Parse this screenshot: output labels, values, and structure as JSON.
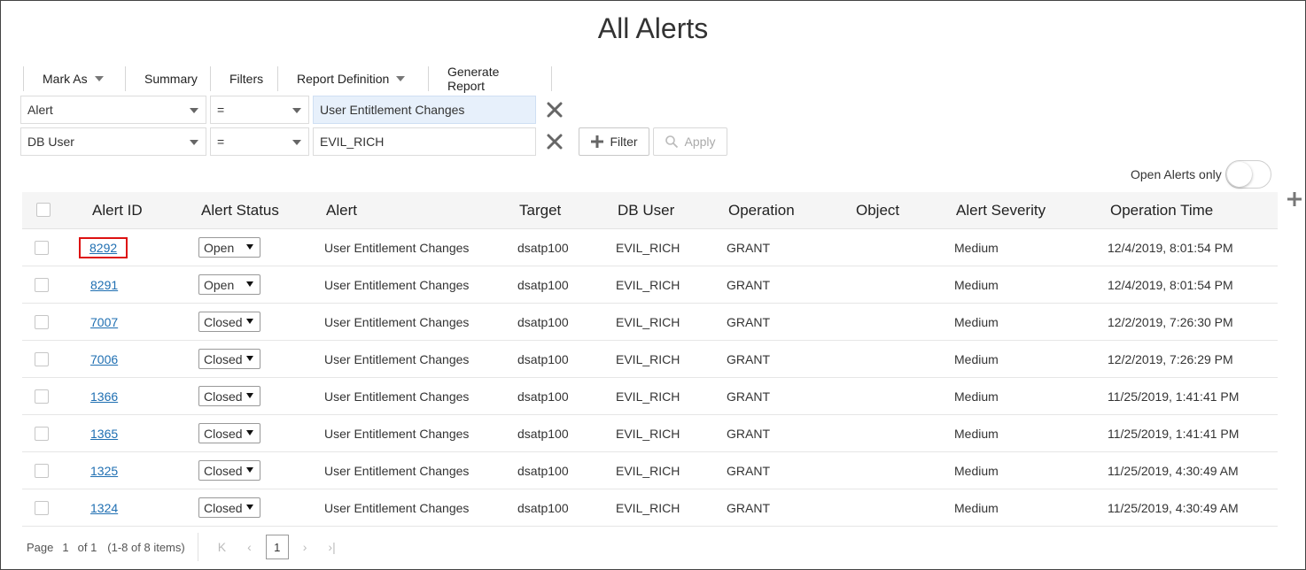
{
  "page": {
    "title": "All Alerts"
  },
  "toolbar": {
    "mark_as": "Mark As",
    "summary": "Summary",
    "filters": "Filters",
    "report_definition": "Report Definition",
    "generate_report": "Generate Report"
  },
  "filters": [
    {
      "field": "Alert",
      "operator": "=",
      "value": "User Entitlement Changes"
    },
    {
      "field": "DB User",
      "operator": "=",
      "value": "EVIL_RICH"
    }
  ],
  "buttons": {
    "add_filter": "Filter",
    "apply": "Apply"
  },
  "open_alerts_toggle": {
    "label": "Open Alerts only",
    "on": false
  },
  "columns": [
    "Alert ID",
    "Alert Status",
    "Alert",
    "Target",
    "DB User",
    "Operation",
    "Object",
    "Alert Severity",
    "Operation Time"
  ],
  "rows": [
    {
      "id": "8292",
      "status": "Open",
      "alert": "User Entitlement Changes",
      "target": "dsatp100",
      "db_user": "EVIL_RICH",
      "operation": "GRANT",
      "object": "",
      "severity": "Medium",
      "time": "12/4/2019, 8:01:54 PM"
    },
    {
      "id": "8291",
      "status": "Open",
      "alert": "User Entitlement Changes",
      "target": "dsatp100",
      "db_user": "EVIL_RICH",
      "operation": "GRANT",
      "object": "",
      "severity": "Medium",
      "time": "12/4/2019, 8:01:54 PM"
    },
    {
      "id": "7007",
      "status": "Closed",
      "alert": "User Entitlement Changes",
      "target": "dsatp100",
      "db_user": "EVIL_RICH",
      "operation": "GRANT",
      "object": "",
      "severity": "Medium",
      "time": "12/2/2019, 7:26:30 PM"
    },
    {
      "id": "7006",
      "status": "Closed",
      "alert": "User Entitlement Changes",
      "target": "dsatp100",
      "db_user": "EVIL_RICH",
      "operation": "GRANT",
      "object": "",
      "severity": "Medium",
      "time": "12/2/2019, 7:26:29 PM"
    },
    {
      "id": "1366",
      "status": "Closed",
      "alert": "User Entitlement Changes",
      "target": "dsatp100",
      "db_user": "EVIL_RICH",
      "operation": "GRANT",
      "object": "",
      "severity": "Medium",
      "time": "11/25/2019, 1:41:41 PM"
    },
    {
      "id": "1365",
      "status": "Closed",
      "alert": "User Entitlement Changes",
      "target": "dsatp100",
      "db_user": "EVIL_RICH",
      "operation": "GRANT",
      "object": "",
      "severity": "Medium",
      "time": "11/25/2019, 1:41:41 PM"
    },
    {
      "id": "1325",
      "status": "Closed",
      "alert": "User Entitlement Changes",
      "target": "dsatp100",
      "db_user": "EVIL_RICH",
      "operation": "GRANT",
      "object": "",
      "severity": "Medium",
      "time": "11/25/2019, 4:30:49 AM"
    },
    {
      "id": "1324",
      "status": "Closed",
      "alert": "User Entitlement Changes",
      "target": "dsatp100",
      "db_user": "EVIL_RICH",
      "operation": "GRANT",
      "object": "",
      "severity": "Medium",
      "time": "11/25/2019, 4:30:49 AM"
    }
  ],
  "pagination": {
    "page_label": "Page",
    "current_page": "1",
    "of_label": "of 1",
    "items_summary": "(1-8 of 8 items)",
    "page_button": "1"
  },
  "colors": {
    "link": "#1f6fb2",
    "highlight_box": "#d11111",
    "filter_value_bg": "#e7f0fb"
  },
  "icons": {
    "remove_filter": "x-icon",
    "add_filter": "plus-icon",
    "apply": "search-icon",
    "add_column": "plus-icon",
    "pager": [
      "first-page-icon",
      "prev-page-icon",
      "next-page-icon",
      "last-page-icon"
    ]
  }
}
